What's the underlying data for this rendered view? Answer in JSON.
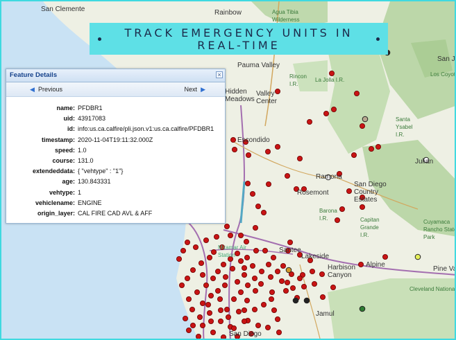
{
  "banner": {
    "title_line1": "TRACK EMERGENCY UNITS IN",
    "title_line2": "REAL-TIME"
  },
  "popup": {
    "title": "Feature Details",
    "close_label": "×",
    "prev_label": "Previous",
    "next_label": "Next",
    "fields": [
      {
        "key": "name:",
        "value": "PFDBR1"
      },
      {
        "key": "uid:",
        "value": "43917083"
      },
      {
        "key": "id:",
        "value": "info:us.ca.calfire/pli.json.v1:us.ca.calfire/PFDBR1"
      },
      {
        "key": "timestamp:",
        "value": "2020-11-04T19:11:32.000Z"
      },
      {
        "key": "speed:",
        "value": "1.0"
      },
      {
        "key": "course:",
        "value": "131.0"
      },
      {
        "key": "extendeddata:",
        "value": "{ \"vehtype\" : \"1\"}"
      },
      {
        "key": "age:",
        "value": "130.843331"
      },
      {
        "key": "vehtype:",
        "value": "1"
      },
      {
        "key": "vehiclename:",
        "value": "ENGINE"
      },
      {
        "key": "origin_layer:",
        "value": "CAL FIRE CAD AVL & AFF"
      }
    ]
  },
  "map": {
    "places": [
      {
        "text": "San Clemente",
        "cls": ""
      },
      {
        "text": "Rainbow",
        "cls": ""
      },
      {
        "text": "Agua Tibia Wilderness",
        "cls": "green"
      },
      {
        "text": "San Jo",
        "cls": ""
      },
      {
        "text": "Pauma Valley",
        "cls": ""
      },
      {
        "text": "Rincon I.R.",
        "cls": "green"
      },
      {
        "text": "La Jolla I.R.",
        "cls": "green"
      },
      {
        "text": "Los Coyotes I.R.",
        "cls": "green"
      },
      {
        "text": "Valley Center",
        "cls": ""
      },
      {
        "text": "Hidden Meadows",
        "cls": ""
      },
      {
        "text": "Santa Ysabel I.R.",
        "cls": "green"
      },
      {
        "text": "Escondido",
        "cls": ""
      },
      {
        "text": "Ramona",
        "cls": ""
      },
      {
        "text": "San Diego Country Estates",
        "cls": ""
      },
      {
        "text": "Rosemont",
        "cls": ""
      },
      {
        "text": "Barona I.R.",
        "cls": "green"
      },
      {
        "text": "Capitan Grande I.R.",
        "cls": "green"
      },
      {
        "text": "Cuyamaca Rancho State Park",
        "cls": "green"
      },
      {
        "text": "Julian",
        "cls": ""
      },
      {
        "text": "Santee",
        "cls": ""
      },
      {
        "text": "Lakeside",
        "cls": ""
      },
      {
        "text": "Harbison Canyon",
        "cls": ""
      },
      {
        "text": "Alpine",
        "cls": ""
      },
      {
        "text": "Pine Valley",
        "cls": ""
      },
      {
        "text": "Cleveland National Forest",
        "cls": "green"
      },
      {
        "text": "Jamul",
        "cls": ""
      },
      {
        "text": "San Diego",
        "cls": ""
      },
      {
        "text": "Miramar Air Station",
        "cls": "small"
      }
    ]
  },
  "colors": {
    "banner_bg": "#5ee0e6",
    "marker_red": "#c81414",
    "border_accent": "#3fd9e0"
  }
}
